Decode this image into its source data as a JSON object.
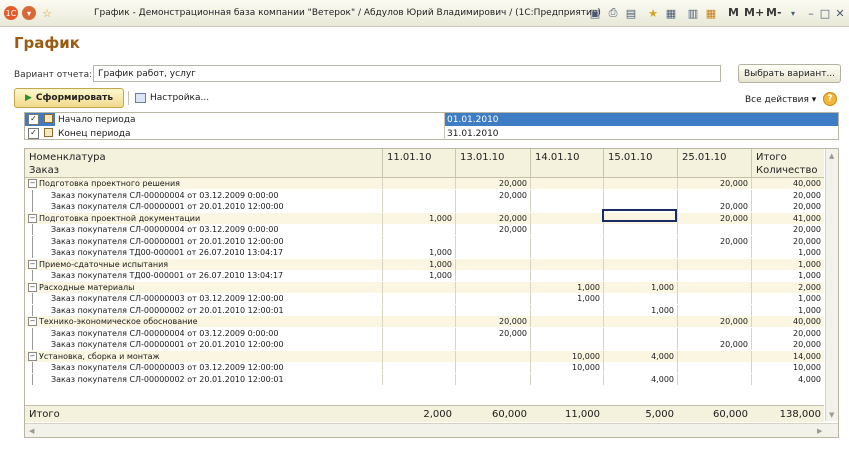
{
  "window": {
    "title": "График - Демонстрационная база компании \"Ветерок\" / Абдулов Юрий Владимирович / (1С:Предприятие)",
    "memory_buttons": [
      "M",
      "M+",
      "M-"
    ]
  },
  "page_title": "График",
  "variant": {
    "label": "Вариант отчета:",
    "value": "График работ, услуг",
    "select_button": "Выбрать вариант..."
  },
  "toolbar": {
    "generate_label": "Сформировать",
    "settings_label": "Настройка...",
    "all_actions_label": "Все действия ▾",
    "help": "?"
  },
  "parameters": [
    {
      "name": "Начало периода",
      "value": "01.01.2010",
      "checked": true,
      "selected": true
    },
    {
      "name": "Конец периода",
      "value": "31.01.2010",
      "checked": true,
      "selected": false
    }
  ],
  "report": {
    "headers": {
      "row1": "Номенклатура",
      "row2": "Заказ",
      "dates": [
        "11.01.10",
        "13.01.10",
        "14.01.10",
        "15.01.10",
        "25.01.10"
      ],
      "total": "Итого",
      "quantity": "Количество"
    },
    "rows": [
      {
        "type": "group",
        "label": "Подготовка проектного решения",
        "values": [
          "",
          "20,000",
          "",
          "",
          "20,000",
          "40,000"
        ]
      },
      {
        "type": "item",
        "label": "Заказ покупателя СЛ-00000004 от 03.12.2009 0:00:00",
        "values": [
          "",
          "20,000",
          "",
          "",
          "",
          "20,000"
        ]
      },
      {
        "type": "item",
        "label": "Заказ покупателя СЛ-00000001 от 20.01.2010 12:00:00",
        "values": [
          "",
          "",
          "",
          "",
          "20,000",
          "20,000"
        ]
      },
      {
        "type": "group",
        "label": "Подготовка проектной документации",
        "values": [
          "1,000",
          "20,000",
          "",
          "",
          "20,000",
          "41,000"
        ]
      },
      {
        "type": "item",
        "label": "Заказ покупателя СЛ-00000004 от 03.12.2009 0:00:00",
        "values": [
          "",
          "20,000",
          "",
          "",
          "",
          "20,000"
        ]
      },
      {
        "type": "item",
        "label": "Заказ покупателя СЛ-00000001 от 20.01.2010 12:00:00",
        "values": [
          "",
          "",
          "",
          "",
          "20,000",
          "20,000"
        ]
      },
      {
        "type": "item",
        "label": "Заказ покупателя ТД00-000001 от 26.07.2010 13:04:17",
        "values": [
          "1,000",
          "",
          "",
          "",
          "",
          "1,000"
        ]
      },
      {
        "type": "group",
        "label": "Приемо-сдаточные испытания",
        "values": [
          "1,000",
          "",
          "",
          "",
          "",
          "1,000"
        ]
      },
      {
        "type": "item",
        "label": "Заказ покупателя ТД00-000001 от 26.07.2010 13:04:17",
        "values": [
          "1,000",
          "",
          "",
          "",
          "",
          "1,000"
        ]
      },
      {
        "type": "group",
        "label": "Расходные материалы",
        "values": [
          "",
          "",
          "1,000",
          "1,000",
          "",
          "2,000"
        ]
      },
      {
        "type": "item",
        "label": "Заказ покупателя СЛ-00000003 от 03.12.2009 12:00:00",
        "values": [
          "",
          "",
          "1,000",
          "",
          "",
          "1,000"
        ]
      },
      {
        "type": "item",
        "label": "Заказ покупателя СЛ-00000002 от 20.01.2010 12:00:01",
        "values": [
          "",
          "",
          "",
          "1,000",
          "",
          "1,000"
        ]
      },
      {
        "type": "group",
        "label": "Технико-экономическое обоснование",
        "values": [
          "",
          "20,000",
          "",
          "",
          "20,000",
          "40,000"
        ]
      },
      {
        "type": "item",
        "label": "Заказ покупателя СЛ-00000004 от 03.12.2009 0:00:00",
        "values": [
          "",
          "20,000",
          "",
          "",
          "",
          "20,000"
        ]
      },
      {
        "type": "item",
        "label": "Заказ покупателя СЛ-00000001 от 20.01.2010 12:00:00",
        "values": [
          "",
          "",
          "",
          "",
          "20,000",
          "20,000"
        ]
      },
      {
        "type": "group",
        "label": "Установка, сборка и монтаж",
        "values": [
          "",
          "",
          "10,000",
          "4,000",
          "",
          "14,000"
        ]
      },
      {
        "type": "item",
        "label": "Заказ покупателя СЛ-00000003 от 03.12.2009 12:00:00",
        "values": [
          "",
          "",
          "10,000",
          "",
          "",
          "10,000"
        ]
      },
      {
        "type": "item",
        "label": "Заказ покупателя СЛ-00000002 от 20.01.2010 12:00:01",
        "values": [
          "",
          "",
          "",
          "4,000",
          "",
          "4,000"
        ]
      }
    ],
    "total": {
      "label": "Итого",
      "values": [
        "2,000",
        "60,000",
        "11,000",
        "5,000",
        "60,000",
        "138,000"
      ]
    }
  },
  "colors": {
    "accent_title": "#9a5b12",
    "selection_blue": "#3e7cc4",
    "header_bg": "#f4f1dd"
  }
}
